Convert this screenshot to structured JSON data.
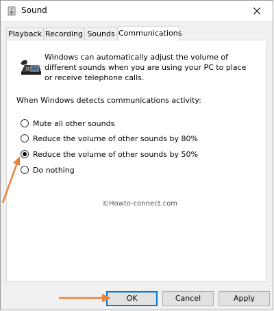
{
  "window": {
    "title": "Sound"
  },
  "tabs": [
    {
      "label": "Playback"
    },
    {
      "label": "Recording"
    },
    {
      "label": "Sounds"
    },
    {
      "label": "Communications",
      "active": true
    }
  ],
  "communications": {
    "description": "Windows can automatically adjust the volume of different sounds when you are using your PC to place or receive telephone calls.",
    "prompt": "When Windows detects communications activity:",
    "options": [
      {
        "label": "Mute all other sounds",
        "selected": false
      },
      {
        "label": "Reduce the volume of other sounds by 80%",
        "selected": false
      },
      {
        "label": "Reduce the volume of other sounds by 50%",
        "selected": true
      },
      {
        "label": "Do nothing",
        "selected": false
      }
    ]
  },
  "watermark": "©Howto-connect.com",
  "buttons": {
    "ok": "OK",
    "cancel": "Cancel",
    "apply": "Apply"
  },
  "colors": {
    "accent": "#0078d7",
    "arrow": "#e8823a"
  },
  "icons": [
    "speaker-icon",
    "close-icon",
    "telephone-icon"
  ]
}
